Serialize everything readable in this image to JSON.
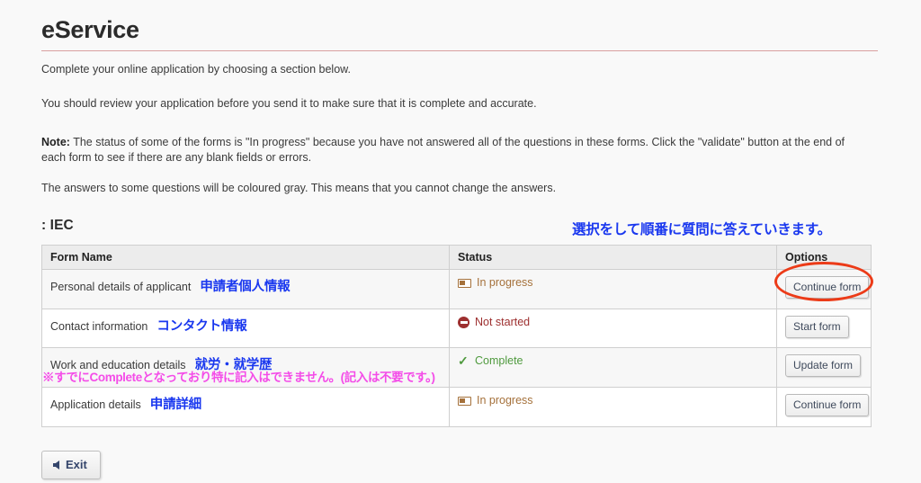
{
  "header": {
    "app_title": "eService",
    "rule_color": "#d9a0a0"
  },
  "intro": {
    "line1": "Complete your online application by choosing a section below.",
    "line2": "You should review your application before you send it to make sure that it is complete and accurate.",
    "note_label": "Note:",
    "note_body": " The status of some of the forms is \"In progress\" because you have not answered all of the questions in these forms. Click the \"validate\" button at the end of each form to see if there are any blank fields or errors.",
    "line4": "The answers to some questions will be coloured gray. This means that you cannot change the answers."
  },
  "section": {
    "heading": ": IEC"
  },
  "annotations": {
    "blue_top": "選択をして順番に質問に答えていきます。",
    "blue_color": "#1a38ef",
    "pink_note": "※すでにCompleteとなっており特に記入はできません。(記入は不要です。)",
    "pink_color": "#f44ce8",
    "ellipse_color": "#ec3b18"
  },
  "table": {
    "columns": [
      "Form Name",
      "Status",
      "Options"
    ],
    "rows": [
      {
        "name_en": "Personal details of applicant",
        "name_jp": "申請者個人情報",
        "status_icon": "progress-bar-icon",
        "status": "In progress",
        "status_color": "#a5713b",
        "button": "Continue form"
      },
      {
        "name_en": "Contact information",
        "name_jp": "コンタクト情報",
        "status_icon": "no-entry-icon",
        "status": "Not started",
        "status_color": "#9d2f2f",
        "button": "Start form"
      },
      {
        "name_en": "Work and education details",
        "name_jp": "就労・就学歴",
        "status_icon": "check-icon",
        "status": "Complete",
        "status_color": "#4f9a3e",
        "button": "Update form"
      },
      {
        "name_en": "Application details",
        "name_jp": "申請詳細",
        "status_icon": "progress-bar-icon",
        "status": "In progress",
        "status_color": "#a5713b",
        "button": "Continue form"
      }
    ]
  },
  "footer": {
    "exit_label": "Exit"
  }
}
